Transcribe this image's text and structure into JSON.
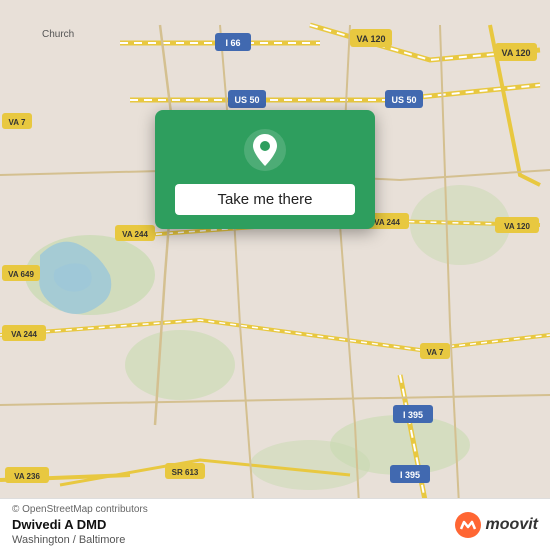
{
  "map": {
    "attribution": "© OpenStreetMap contributors",
    "background_color": "#e8e0d8"
  },
  "popup": {
    "button_label": "Take me there",
    "background_color": "#2e9e5e"
  },
  "bottom_bar": {
    "title": "Dwivedi A DMD",
    "subtitle": "Washington / Baltimore",
    "attribution": "© OpenStreetMap contributors",
    "moovit_label": "moovit"
  }
}
